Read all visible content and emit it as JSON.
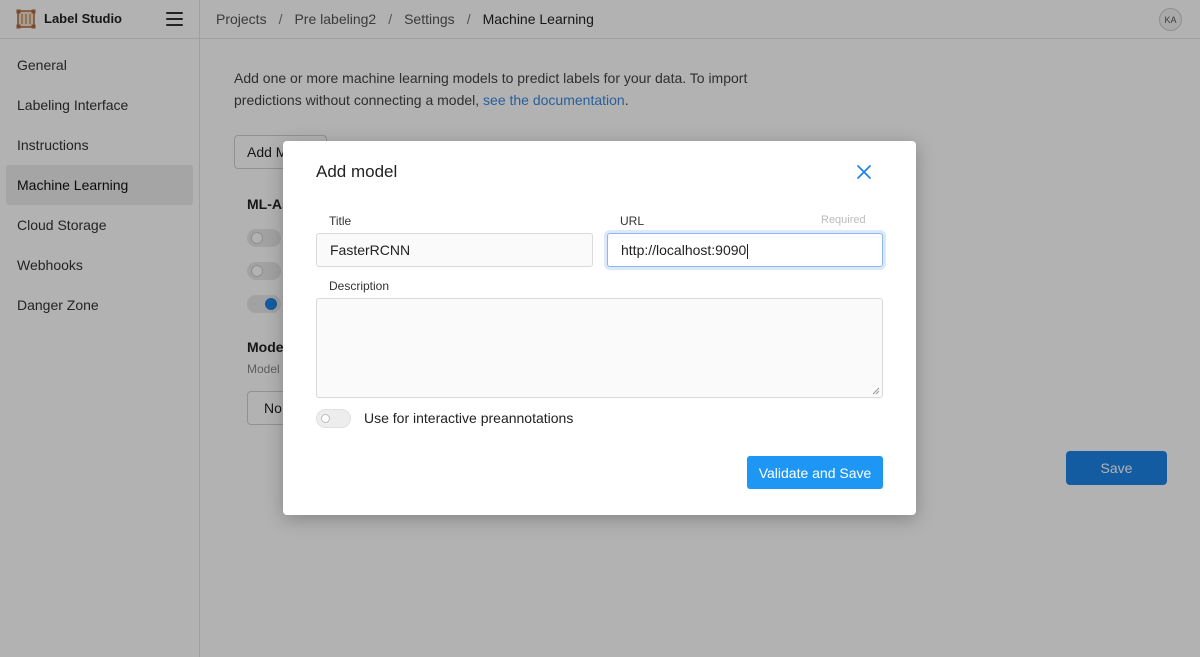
{
  "app": {
    "name": "Label Studio"
  },
  "breadcrumb": [
    "Projects",
    "Pre labeling2",
    "Settings",
    "Machine Learning"
  ],
  "user": {
    "initials": "KA"
  },
  "sidebar": {
    "items": [
      {
        "label": "General"
      },
      {
        "label": "Labeling Interface"
      },
      {
        "label": "Instructions"
      },
      {
        "label": "Machine Learning",
        "active": true
      },
      {
        "label": "Cloud Storage"
      },
      {
        "label": "Webhooks"
      },
      {
        "label": "Danger Zone"
      }
    ]
  },
  "main": {
    "intro_text": "Add one or more machine learning models to predict labels for your data. To import predictions without connecting a model,",
    "intro_link": "see the documentation",
    "intro_end": ".",
    "add_model_button": "Add Model",
    "ml_assisted_title": "ML-Assisted Labeling",
    "model_section_title": "Model Version",
    "model_section_sub": "Model Version",
    "no_button": "No Version",
    "save_button": "Save"
  },
  "modal": {
    "title": "Add model",
    "title_field": {
      "label": "Title",
      "value": "FasterRCNN"
    },
    "url_field": {
      "label": "URL",
      "required_text": "Required",
      "value": "http://localhost:9090"
    },
    "description_field": {
      "label": "Description",
      "value": ""
    },
    "interactive_toggle_label": "Use for interactive preannotations",
    "validate_button": "Validate and Save"
  },
  "colors": {
    "accent": "#1d97f3",
    "link": "#3a88e0"
  }
}
